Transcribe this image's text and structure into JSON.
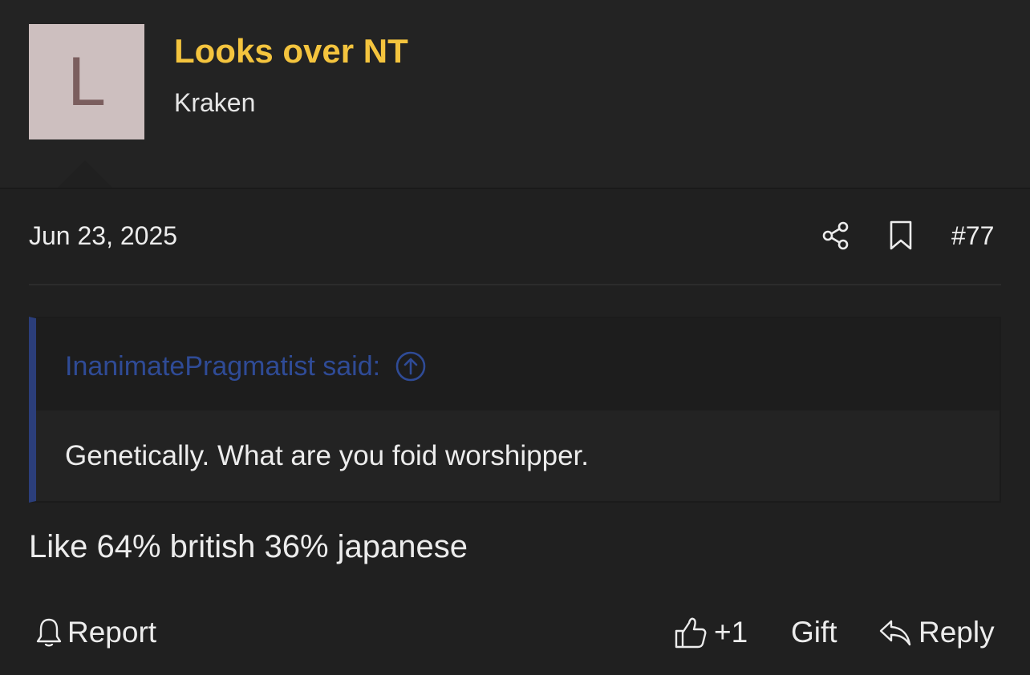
{
  "user": {
    "avatar_letter": "L",
    "name": "Looks over NT",
    "title": "Kraken"
  },
  "post": {
    "date": "Jun 23, 2025",
    "number": "#77",
    "body": "Like 64% british 36% japanese"
  },
  "quote": {
    "author_label": "InanimatePragmatist said:",
    "text": "Genetically. What are you foid worshipper."
  },
  "actions": {
    "report": "Report",
    "like": "+1",
    "gift": "Gift",
    "reply": "Reply"
  },
  "colors": {
    "background": "#202020",
    "username": "#f4c43e",
    "quote_accent": "#2b3e7a",
    "quote_author": "#2f4b96",
    "avatar_bg": "#cdbfbf",
    "avatar_letter": "#7b5e5e"
  },
  "icons": [
    "share-icon",
    "bookmark-icon",
    "arrow-up-circle-icon",
    "bell-icon",
    "thumbs-up-icon",
    "reply-arrow-icon"
  ]
}
